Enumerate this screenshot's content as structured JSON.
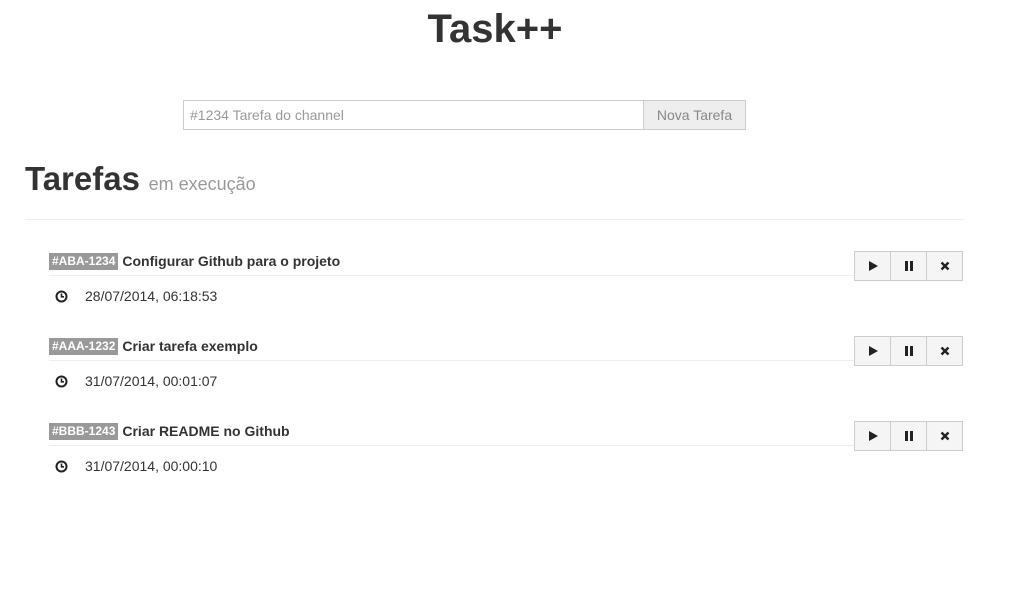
{
  "header": {
    "title": "Task++"
  },
  "new_task": {
    "placeholder": "#1234 Tarefa do channel",
    "value": "",
    "button_label": "Nova Tarefa"
  },
  "section": {
    "title": "Tarefas",
    "subtitle": "em execução"
  },
  "icons": {
    "clock": "clock-icon",
    "play": "play-icon",
    "pause": "pause-icon",
    "remove": "close-icon"
  },
  "tasks": [
    {
      "code": "#ABA-1234",
      "name": "Configurar Github para o projeto",
      "timestamp": "28/07/2014, 06:18:53"
    },
    {
      "code": "#AAA-1232",
      "name": "Criar tarefa exemplo",
      "timestamp": "31/07/2014, 00:01:07"
    },
    {
      "code": "#BBB-1243",
      "name": "Criar README no Github",
      "timestamp": "31/07/2014, 00:00:10"
    }
  ]
}
